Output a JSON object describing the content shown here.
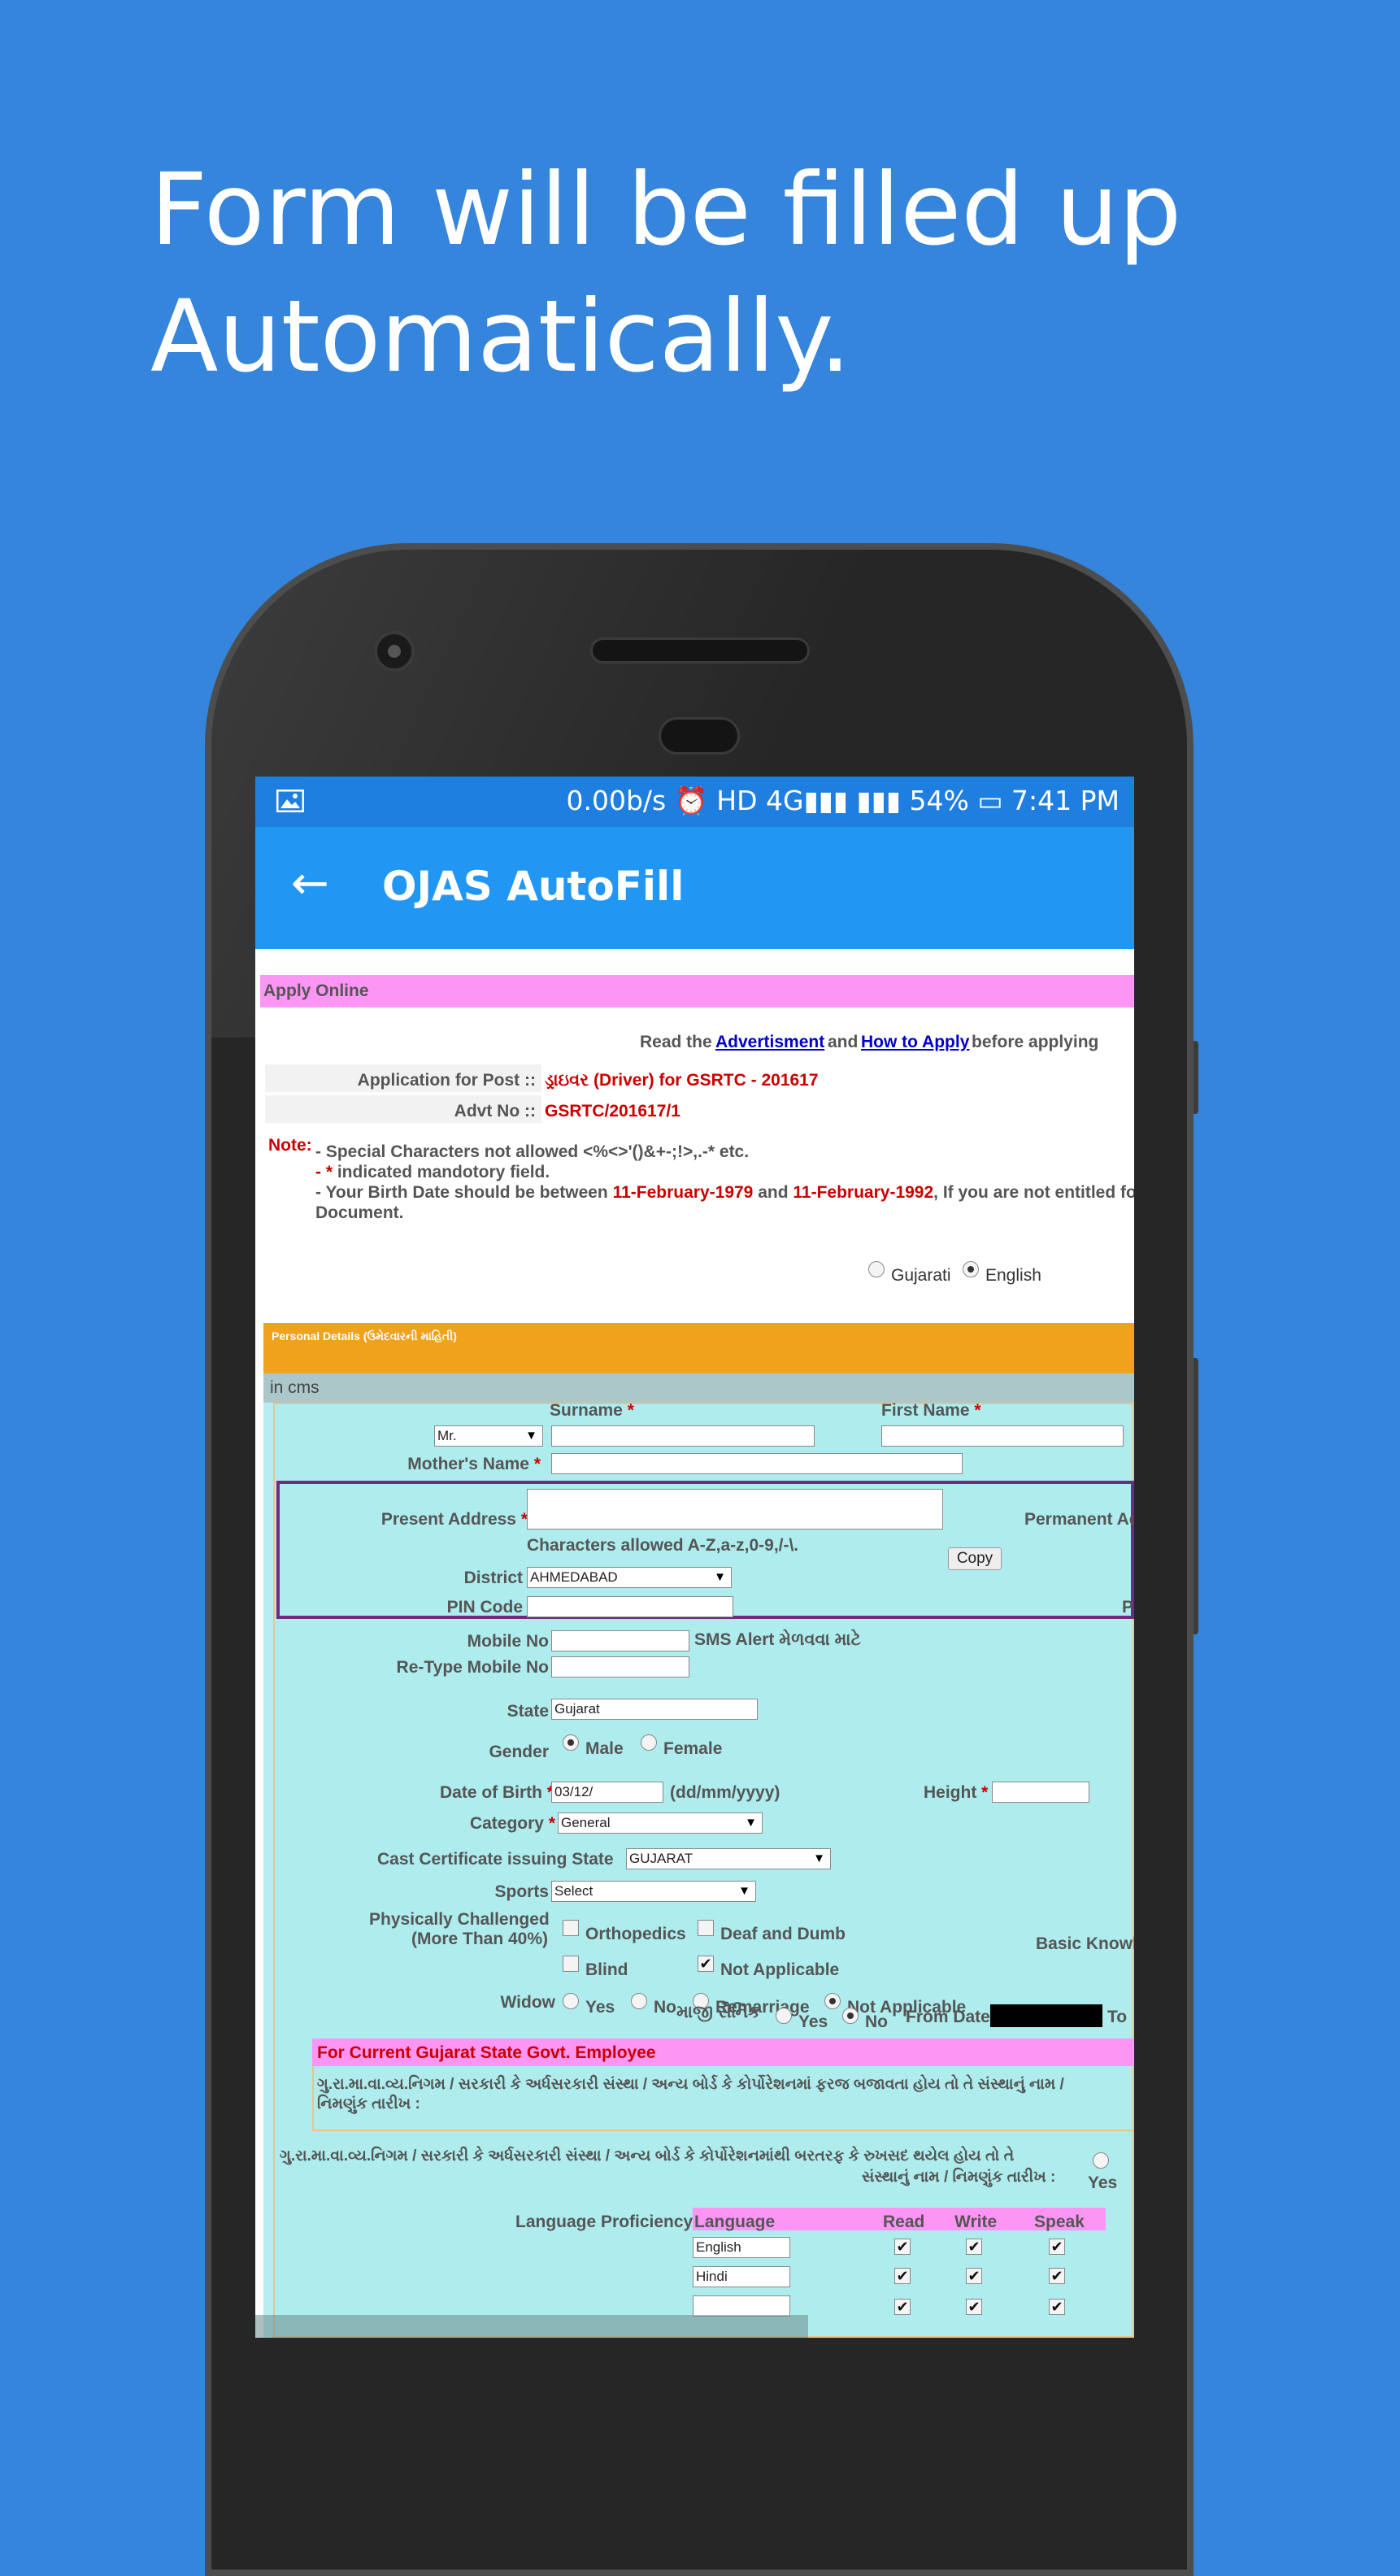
{
  "headline": {
    "line1": "Form will be filled up",
    "line2": "Automatically."
  },
  "status_bar": {
    "text": "0.00b/s ⏰ HD 4G▮▮▮ ▮▮▮ 54% ▭ 7:41 PM"
  },
  "app_bar": {
    "title": "OJAS AutoFill",
    "back_icon": "arrow-back-icon"
  },
  "web": {
    "apply_online": "Apply Online",
    "read_prefix": "Read the",
    "advertisment_link": "Advertisment",
    "and": "and",
    "how_to_apply_link": "How to Apply",
    "read_suffix": "before applying",
    "post_label": "Application for Post ::",
    "post_value": "ડ્રાઇવર (Driver) for GSRTC - 201617",
    "advt_label": "Advt No ::",
    "advt_value": "GSRTC/201617/1",
    "note_label": "Note:",
    "note_line1": "- Special Characters not allowed <%<>'()&+-;!>,.-* etc.",
    "note_line2_star": "- *",
    "note_line2": " indicated mandotory field.",
    "note_line3_a": "- Your Birth Date should be between ",
    "note_line3_d1": "11-February-1979",
    "note_line3_b": " and ",
    "note_line3_d2": "11-February-1992",
    "note_line3_c": ", If you are not entitled fo",
    "note_line4": "Document.",
    "lang_gujarati": "Gujarati",
    "lang_english": "English",
    "personal_details": "Personal Details (ઉમેદવારની માહિતી)",
    "in_cms": "in cms",
    "surname_label": "Surname",
    "first_name_label": "First Name",
    "title_select": "Mr.",
    "mother_name_label": "Mother's Name",
    "present_address_label": "Present Address",
    "permanent_address_label": "Permanent Ad",
    "chars_allowed": "Characters allowed A-Z,a-z,0-9,/-\\.",
    "copy_button": "Copy",
    "district_label": "District",
    "district_value": "AHMEDABAD",
    "pin_code_label": "PIN Code",
    "pin_right": "P",
    "mobile_label": "Mobile No",
    "sms_alert": "SMS Alert મેળવવા માટે",
    "retype_mobile_label": "Re-Type Mobile No",
    "state_label": "State",
    "state_value": "Gujarat",
    "gender_label": "Gender",
    "male": "Male",
    "female": "Female",
    "dob_label": "Date of Birth",
    "dob_value": "03/12/",
    "dob_format": "(dd/mm/yyyy)",
    "height_label": "Height",
    "category_label": "Category",
    "category_value": "General",
    "cast_cert_label": "Cast Certificate issuing State",
    "cast_cert_value": "GUJARAT",
    "sports_label": "Sports",
    "sports_value": "Select",
    "physically_label1": "Physically Challenged",
    "physically_label2": "(More Than 40%)",
    "orthopedics": "Orthopedics",
    "deaf_dumb": "Deaf and Dumb",
    "blind": "Blind",
    "not_applicable": "Not Applicable",
    "basic_knowledge": "Basic Knowl",
    "widow_label": "Widow",
    "yes": "Yes",
    "no": "No",
    "remarriage": "Remarriage",
    "ex_serviceman_label": "માજી સૈનિક",
    "from_date": "From Date",
    "to_label": "To",
    "employee_title": "For Current Gujarat State Govt. Employee",
    "employee_line1": "ગુ.રા.મા.વા.વ્ય.નિગમ / સરકારી કે અર્ધસરકારી સંસ્થા / અન્ય બોર્ડ કે કોર્પોરેશનમાં ફરજ બજાવતા હોય તો તે સંસ્થાનું નામ /",
    "employee_line2": "નિમણુંક તારીખ :",
    "retired_line1": "ગુ.રા.મા.વા.વ્ય.નિગમ / સરકારી કે અર્ધસરકારી સંસ્થા / અન્ય બોર્ડ કે કોર્પોરેશનમાંથી બરતરફ કે રુખસદ થયેલ હોય તો તે",
    "retired_line2": "સંસ્થાનું નામ / નિમણુંક તારીખ :",
    "language_proficiency": "Language Proficiency",
    "lang_columns": [
      "Language",
      "Read",
      "Write",
      "Speak"
    ],
    "languages": [
      "English",
      "Hindi"
    ]
  }
}
